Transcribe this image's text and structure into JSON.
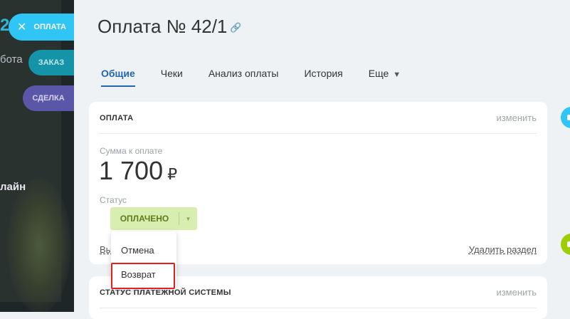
{
  "backdrop": {
    "digit": "2",
    "text_top": "бота",
    "text_mid": "лайн"
  },
  "slider_tabs": {
    "payment": "ОПЛАТА",
    "order": "ЗАКАЗ",
    "deal": "СДЕЛКА"
  },
  "page": {
    "title": "Оплата № 42/1"
  },
  "tabs": [
    {
      "label": "Общие"
    },
    {
      "label": "Чеки"
    },
    {
      "label": "Анализ оплаты"
    },
    {
      "label": "История"
    },
    {
      "label": "Еще"
    }
  ],
  "payment_card": {
    "header": "ОПЛАТА",
    "edit": "изменить",
    "amount_label": "Сумма к оплате",
    "amount": "1 700",
    "currency": "₽",
    "status_label": "Статус",
    "status_value": "ОПЛАЧЕНО",
    "footer_left": "Вы",
    "footer_right": "Удалить раздел"
  },
  "system_card": {
    "header": "СТАТУС ПЛАТЕЖНОЙ СИСТЕМЫ",
    "edit": "изменить"
  },
  "status_dropdown": {
    "items": [
      "Отмена",
      "Возврат"
    ]
  },
  "colors": {
    "accent_blue": "#2067b0",
    "slider_payment": "#2fc6f6",
    "slider_order": "#1593a8",
    "slider_deal": "#5b57a8",
    "status_bg": "#d8eeb0",
    "highlight": "#e02020"
  }
}
